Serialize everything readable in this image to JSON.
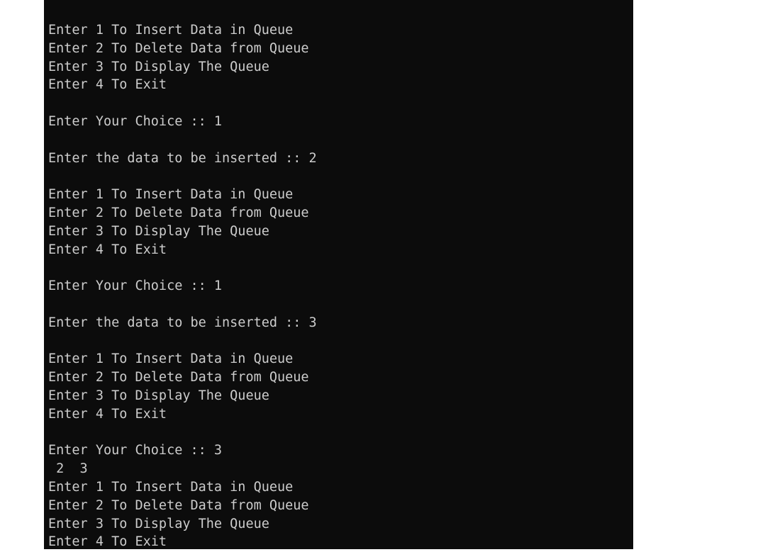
{
  "console": {
    "background": "#0c0c0c",
    "foreground": "#cccccc",
    "lines": [
      "Enter 1 To Insert Data in Queue",
      "Enter 2 To Delete Data from Queue",
      "Enter 3 To Display The Queue",
      "Enter 4 To Exit",
      "",
      "Enter Your Choice :: 1",
      "",
      "Enter the data to be inserted :: 2",
      "",
      "Enter 1 To Insert Data in Queue",
      "Enter 2 To Delete Data from Queue",
      "Enter 3 To Display The Queue",
      "Enter 4 To Exit",
      "",
      "Enter Your Choice :: 1",
      "",
      "Enter the data to be inserted :: 3",
      "",
      "Enter 1 To Insert Data in Queue",
      "Enter 2 To Delete Data from Queue",
      "Enter 3 To Display The Queue",
      "Enter 4 To Exit",
      "",
      "Enter Your Choice :: 3",
      " 2  3",
      "Enter 1 To Insert Data in Queue",
      "Enter 2 To Delete Data from Queue",
      "Enter 3 To Display The Queue",
      "Enter 4 To Exit"
    ]
  }
}
